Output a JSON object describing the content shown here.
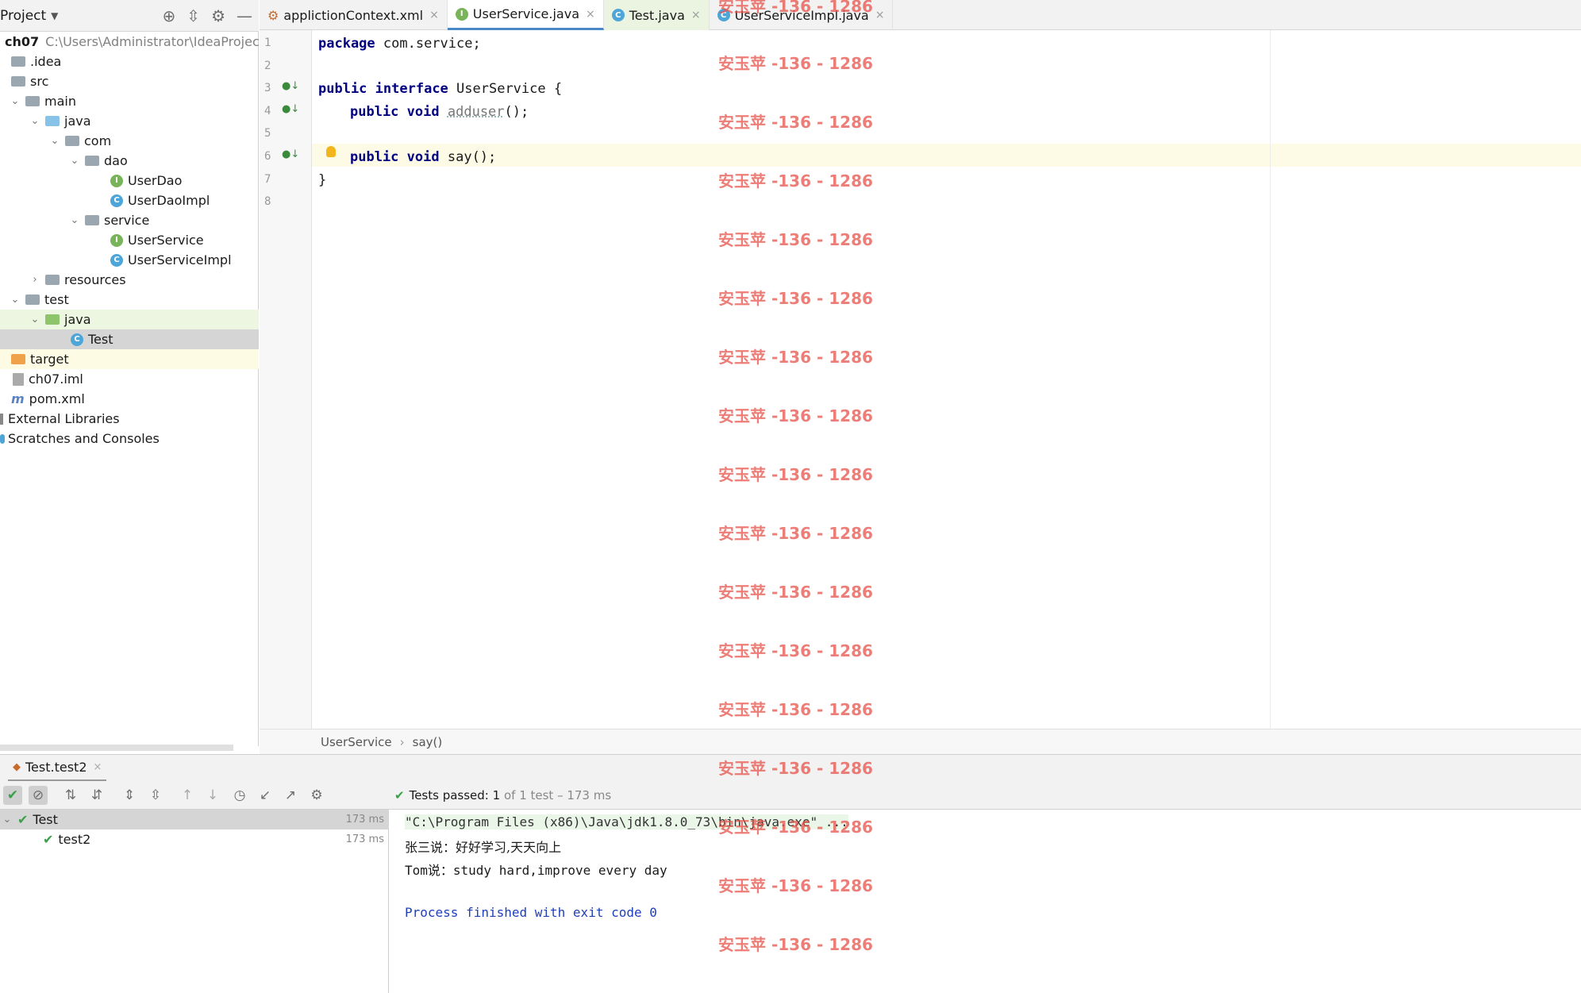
{
  "project_panel": {
    "title": "Project",
    "tree": [
      {
        "label": "ch07",
        "path": "C:\\Users\\Administrator\\IdeaProjects\\",
        "type": "module",
        "bold": true
      },
      {
        "label": ".idea",
        "type": "folder"
      },
      {
        "label": "src",
        "type": "folder"
      },
      {
        "label": "main",
        "type": "folder",
        "expanded": true
      },
      {
        "label": "java",
        "type": "folder-blue",
        "expanded": true
      },
      {
        "label": "com",
        "type": "folder",
        "expanded": true
      },
      {
        "label": "dao",
        "type": "folder",
        "expanded": true
      },
      {
        "label": "UserDao",
        "type": "interface"
      },
      {
        "label": "UserDaoImpl",
        "type": "class"
      },
      {
        "label": "service",
        "type": "folder",
        "expanded": true
      },
      {
        "label": "UserService",
        "type": "interface"
      },
      {
        "label": "UserServiceImpl",
        "type": "class"
      },
      {
        "label": "resources",
        "type": "folder",
        "expanded": false
      },
      {
        "label": "test",
        "type": "folder",
        "expanded": true
      },
      {
        "label": "java",
        "type": "folder-green",
        "expanded": true
      },
      {
        "label": "Test",
        "type": "class",
        "selected": true
      },
      {
        "label": "target",
        "type": "folder-orange"
      },
      {
        "label": "ch07.iml",
        "type": "file"
      },
      {
        "label": "pom.xml",
        "type": "maven"
      },
      {
        "label": "External Libraries",
        "type": "library"
      },
      {
        "label": "Scratches and Consoles",
        "type": "scratch"
      }
    ]
  },
  "tabs": [
    {
      "label": "applictionContext.xml",
      "close": "×"
    },
    {
      "label": "UserService.java",
      "close": "×",
      "active": true
    },
    {
      "label": "Test.java",
      "close": "×"
    },
    {
      "label": "UserServiceImpl.java",
      "close": "×"
    }
  ],
  "editor": {
    "line_numbers": [
      "1",
      "2",
      "3",
      "4",
      "5",
      "6",
      "7",
      "8"
    ],
    "code": {
      "l1_kw": "package",
      "l1_rest": " com.service;",
      "l3_kw1": "public",
      "l3_kw2": "interface",
      "l3_rest": " UserService {",
      "l4_kw1": "public",
      "l4_kw2": "void",
      "l4_name": "adduser",
      "l4_rest": "();",
      "l6_kw1": "public",
      "l6_kw2": "void",
      "l6_rest": " say();",
      "l7": "}"
    }
  },
  "breadcrumb": {
    "item1": "UserService",
    "sep": "›",
    "item2": "say()"
  },
  "run_panel": {
    "tab_label": "Test.test2",
    "status_prefix": "Tests passed:",
    "status_count": "1",
    "status_suffix": "of 1 test – 173 ms",
    "tests": [
      {
        "label": "Test",
        "time": "173 ms"
      },
      {
        "label": "test2",
        "time": "173 ms"
      }
    ],
    "console": [
      "\"C:\\Program Files (x86)\\Java\\jdk1.8.0_73\\bin\\java.exe\" ...",
      "张三说：好好学习,天天向上",
      "Tom说：study hard,improve every day",
      "",
      "Process finished with exit code 0"
    ]
  },
  "watermark": "安玉苹 -136 - 1286",
  "colors": {
    "keyword": "#000080",
    "accent": "#4a88c7",
    "pass": "#3aa04a",
    "watermark": "#e8534a"
  }
}
